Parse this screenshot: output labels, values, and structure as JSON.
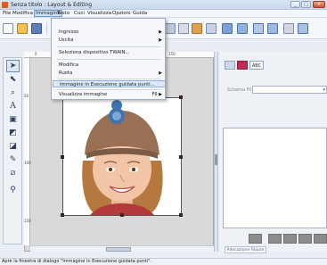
{
  "window": {
    "title": "Senza titolo : Layout & Editing",
    "minimize_icon": "minimize-icon",
    "maximize_icon": "maximize-icon",
    "close_icon": "close-icon"
  },
  "menubar": {
    "items": [
      "File",
      "Modifica",
      "Immagine",
      "Testo",
      "Cuci",
      "Visualizza",
      "Opzioni",
      "Guida"
    ],
    "active": "Immagine"
  },
  "image_menu": {
    "items": [
      {
        "label": "Ingresso",
        "submenu": true
      },
      {
        "label": "Uscita",
        "submenu": true
      },
      {
        "label": "Seleziona dispositivo TWAIN...",
        "submenu": false
      },
      {
        "label": "Modifica",
        "submenu": false
      },
      {
        "label": "Ruota",
        "submenu": true
      },
      {
        "label": "Immagine in Esecuzione guidata punti...",
        "submenu": false,
        "highlighted": true
      },
      {
        "label": "Visualizza immagine",
        "accelerator": "F6"
      }
    ]
  },
  "toolbar_icons": [
    "new-icon",
    "open-icon",
    "save-icon",
    "print-icon",
    "wizard-icon",
    "settings-icon",
    "magic-wand-icon",
    "font-icon",
    "layout-icon",
    "thread-icon",
    "design-icon",
    "stitch-icon",
    "frame-icon"
  ],
  "tool_palette": [
    "select-arrow-icon",
    "point-edit-icon",
    "zoom-icon",
    "text-tool-icon",
    "shape-icon",
    "line-icon",
    "fill-icon",
    "stitch-icon",
    "measure-icon",
    "sewing-icon"
  ],
  "ruler": {
    "labels": [
      "0",
      "50",
      "100",
      "150"
    ]
  },
  "right_panel": {
    "tabs": [
      "",
      "",
      "ABC"
    ],
    "label": "Schema Fil",
    "button_label": "Allocazione Filaure"
  },
  "colors": {
    "title_bar": "#c8d8ec",
    "menu_highlight": "#dbe8f7",
    "canvas_handle": "#3a2323",
    "gray_button": "#8c8c8c"
  },
  "statusbar": {
    "text": "Apre la finestra di dialogo \"Immagine in Esecuzione guidata punti\"."
  }
}
